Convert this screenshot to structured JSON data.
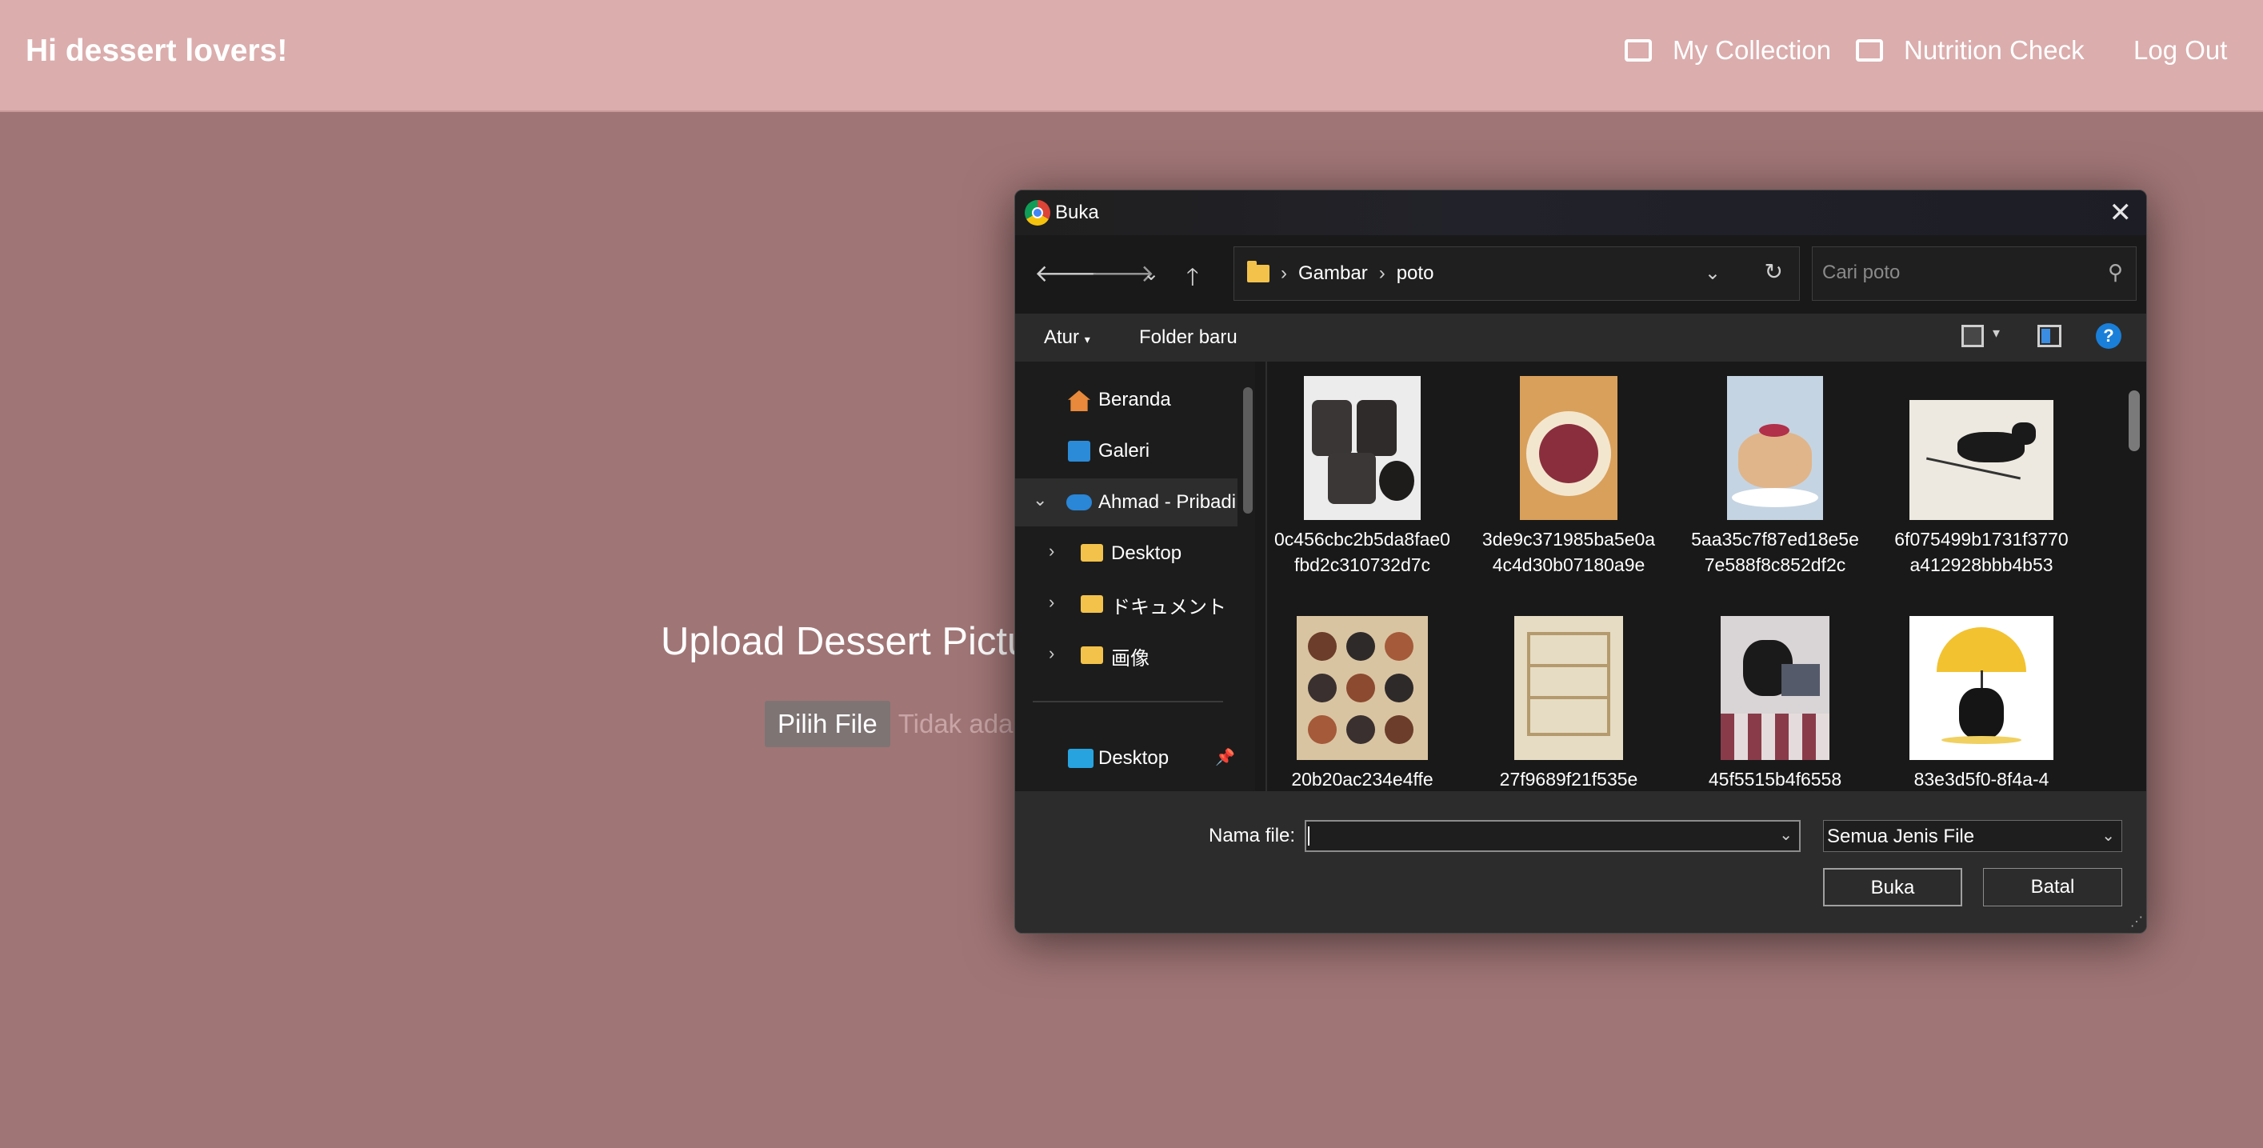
{
  "navbar": {
    "brand": "Hi dessert lovers!",
    "my_collection": "My Collection",
    "nutrition_check": "Nutrition Check",
    "logout": "Log Out"
  },
  "upload": {
    "title": "Upload Dessert Pictu",
    "pick_button": "Pilih File",
    "no_file": "Tidak ada f"
  },
  "dialog": {
    "title": "Buka",
    "breadcrumb": [
      "Gambar",
      "poto"
    ],
    "search_placeholder": "Cari poto",
    "organize": "Atur",
    "new_folder": "Folder baru",
    "help": "?",
    "nav_items": [
      {
        "label": "Beranda",
        "icon": "home-icon"
      },
      {
        "label": "Galeri",
        "icon": "gallery-icon"
      },
      {
        "label": "Ahmad - Pribadi",
        "icon": "onedrive-cloud-icon"
      },
      {
        "label": "Desktop",
        "icon": "folder-icon"
      },
      {
        "label": "ドキュメント",
        "icon": "folder-icon"
      },
      {
        "label": "画像",
        "icon": "folder-icon"
      },
      {
        "label": "Desktop",
        "icon": "desktop-icon"
      }
    ],
    "files": [
      {
        "name": "0c456cbc2b5da8fae0fbd2c310732d7c",
        "thumb": "oreo-cups"
      },
      {
        "name": "3de9c371985ba5e0a4c4d30b07180a9e",
        "thumb": "berry-waffle"
      },
      {
        "name": "5aa35c7f87ed18e5e7e588f8c852df2c",
        "thumb": "pancakes"
      },
      {
        "name": "6f075499b1731f3770a412928bbb4b53",
        "thumb": "black-cat-sketch"
      },
      {
        "name": "20b20ac234e4ffe",
        "thumb": "tart-box"
      },
      {
        "name": "27f9689f21f535e",
        "thumb": "bookshelf-room"
      },
      {
        "name": "45f5515b4f6558",
        "thumb": "cat-laptop"
      },
      {
        "name": "83e3d5f0-8f4a-4",
        "thumb": "cat-umbrella"
      }
    ],
    "filename_label": "Nama file:",
    "filename_value": "",
    "file_type": "Semua Jenis File",
    "open_button": "Buka",
    "cancel_button": "Batal"
  },
  "colors": {
    "page_bg": "#a07576",
    "navbar_bg": "#dbadad",
    "dialog_bg": "#202020",
    "accent_blue": "#1a7fd9"
  }
}
